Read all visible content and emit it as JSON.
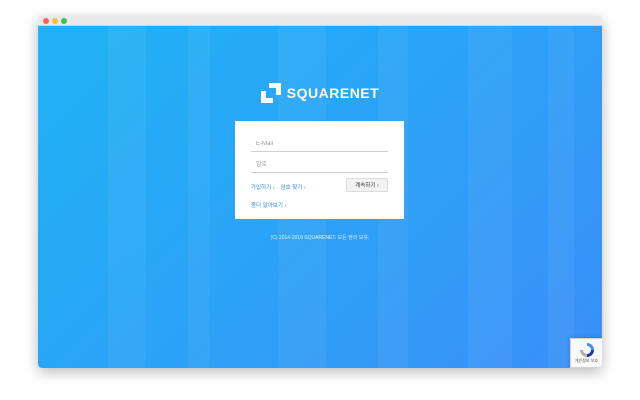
{
  "brand": {
    "name": "SQUARENET"
  },
  "login": {
    "email_placeholder": "E-Mail",
    "password_placeholder": "암호",
    "signup_label": "가입하기 ›",
    "find_password_label": "암호 찾기 ›",
    "continue_label": "계속하기 ›",
    "learn_more_label": "좀더 알아보기 ›"
  },
  "footer": {
    "copyright": "(C) 2014-2019 SQUARENET. 모든 권리 보유."
  },
  "recaptcha": {
    "label": "개인정보 보호"
  },
  "colors": {
    "background_start": "#1fb3f4",
    "background_end": "#3a8ff8",
    "link": "#2b8de0"
  }
}
